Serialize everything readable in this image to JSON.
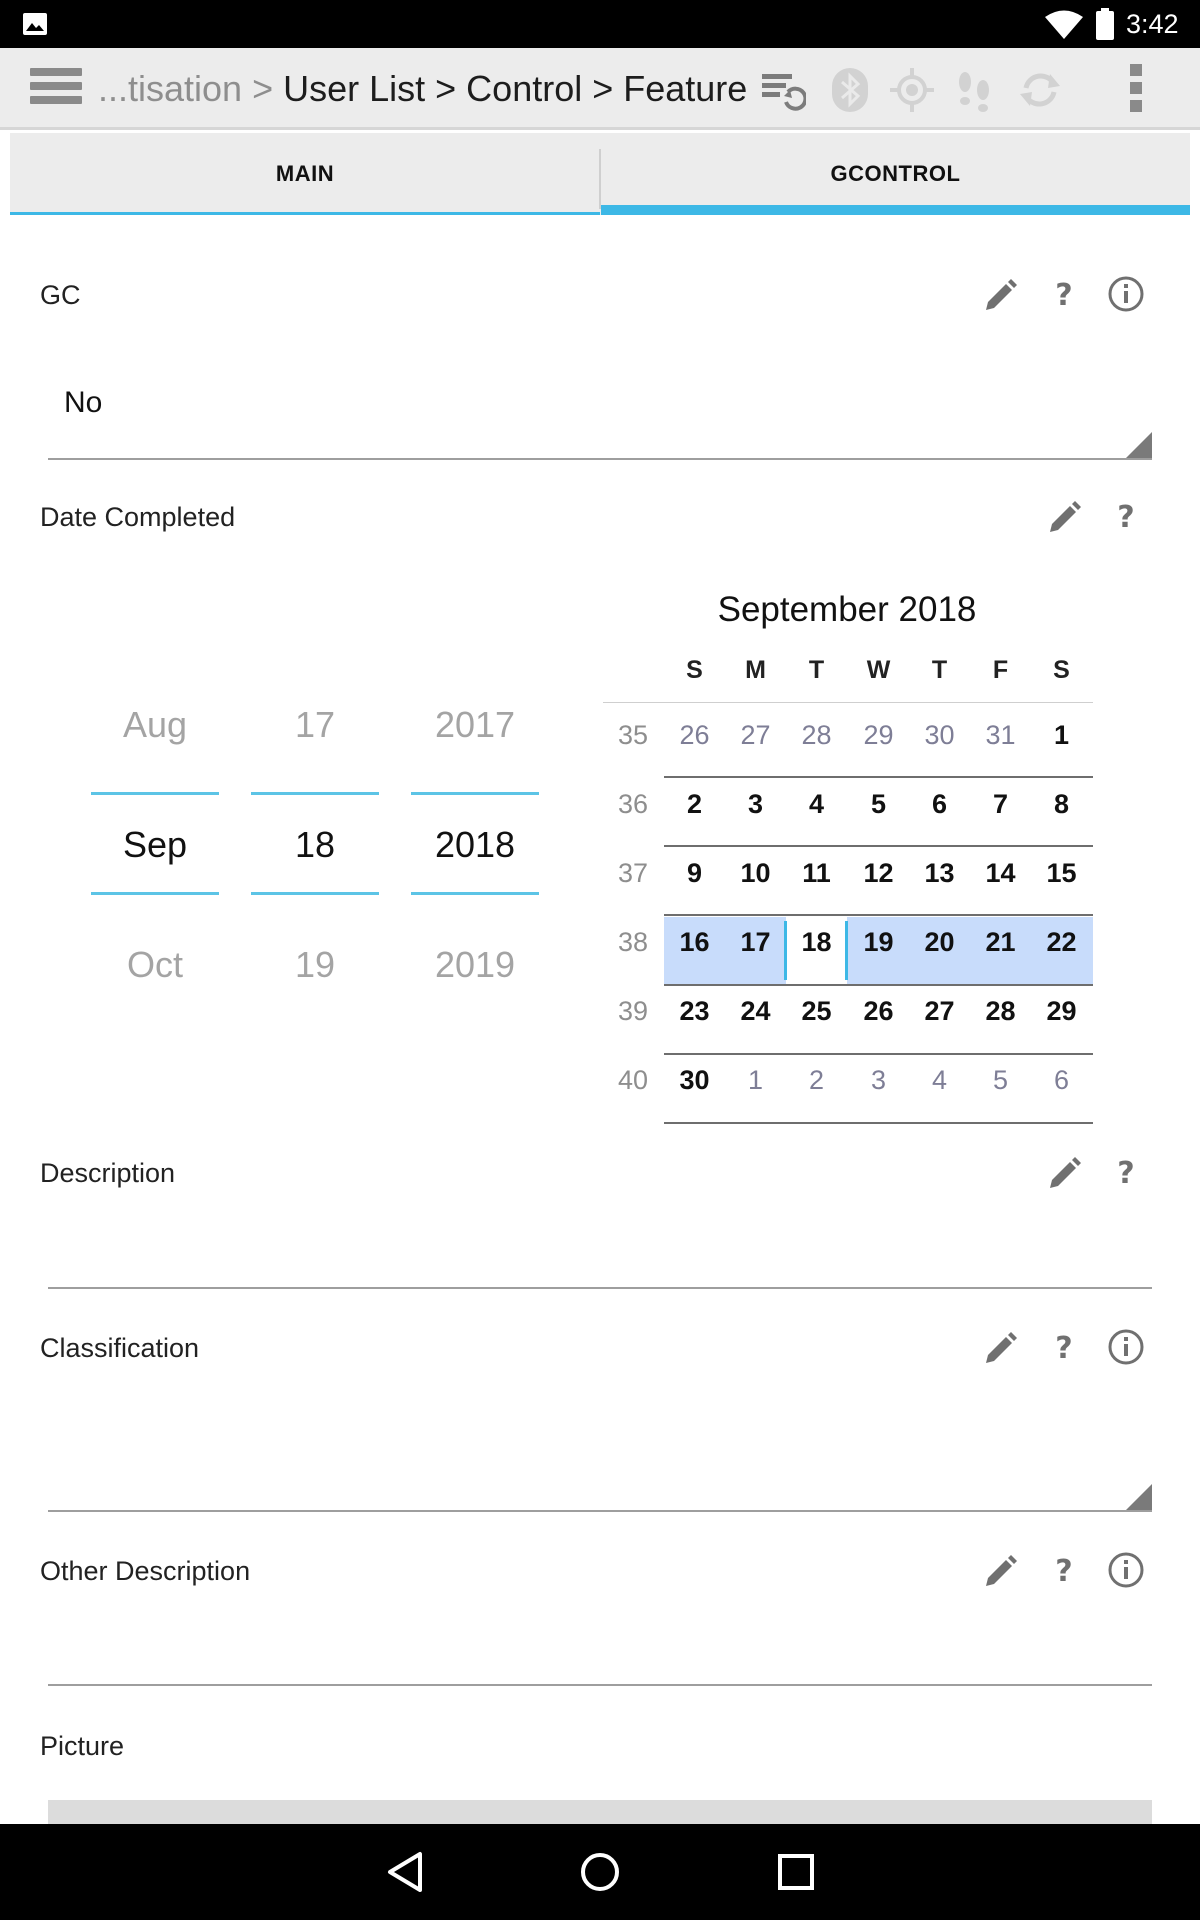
{
  "status_bar": {
    "time": "3:42",
    "icons": [
      "photo-icon",
      "wifi-icon",
      "battery-icon"
    ]
  },
  "toolbar": {
    "breadcrumb_faded": "...tisation",
    "separator": " > ",
    "breadcrumb_trail": "User List > Control > Feature",
    "icons": [
      "menu-icon",
      "sync-settings-icon",
      "bluetooth-icon",
      "gps-icon",
      "footsteps-icon",
      "refresh-icon",
      "overflow-menu-icon"
    ]
  },
  "tabs": [
    {
      "label": "MAIN",
      "active": false
    },
    {
      "label": "GCONTROL",
      "active": true
    }
  ],
  "form": {
    "gc": {
      "label": "GC",
      "value": "No"
    },
    "date_completed": {
      "label": "Date Completed"
    },
    "description": {
      "label": "Description",
      "value": ""
    },
    "classification": {
      "label": "Classification",
      "value": ""
    },
    "other_description": {
      "label": "Other Description",
      "value": ""
    },
    "picture": {
      "label": "Picture"
    }
  },
  "date_picker": {
    "months": [
      "Aug",
      "Sep",
      "Oct"
    ],
    "days": [
      "17",
      "18",
      "19"
    ],
    "years": [
      "2017",
      "2018",
      "2019"
    ]
  },
  "calendar": {
    "title": "September 2018",
    "weekdays": [
      "S",
      "M",
      "T",
      "W",
      "T",
      "F",
      "S"
    ],
    "weeks": [
      {
        "num": "35",
        "days": [
          "26",
          "27",
          "28",
          "29",
          "30",
          "31",
          "1"
        ]
      },
      {
        "num": "36",
        "days": [
          "2",
          "3",
          "4",
          "5",
          "6",
          "7",
          "8"
        ]
      },
      {
        "num": "37",
        "days": [
          "9",
          "10",
          "11",
          "12",
          "13",
          "14",
          "15"
        ]
      },
      {
        "num": "38",
        "days": [
          "16",
          "17",
          "18",
          "19",
          "20",
          "21",
          "22"
        ]
      },
      {
        "num": "39",
        "days": [
          "23",
          "24",
          "25",
          "26",
          "27",
          "28",
          "29"
        ]
      },
      {
        "num": "40",
        "days": [
          "30",
          "1",
          "2",
          "3",
          "4",
          "5",
          "6"
        ]
      }
    ],
    "other_month_mask": [
      [
        true,
        true,
        true,
        true,
        true,
        true,
        false
      ],
      [
        false,
        false,
        false,
        false,
        false,
        false,
        false
      ],
      [
        false,
        false,
        false,
        false,
        false,
        false,
        false
      ],
      [
        false,
        false,
        false,
        false,
        false,
        false,
        false
      ],
      [
        false,
        false,
        false,
        false,
        false,
        false,
        false
      ],
      [
        false,
        true,
        true,
        true,
        true,
        true,
        true
      ]
    ],
    "selected_day": "18",
    "colors": {
      "highlight": "#c8dcfb",
      "accent": "#3db8e6",
      "other_month": "#7e7e96"
    }
  },
  "nav_bar": {
    "icons": [
      "back-icon",
      "home-icon",
      "recents-icon"
    ]
  }
}
